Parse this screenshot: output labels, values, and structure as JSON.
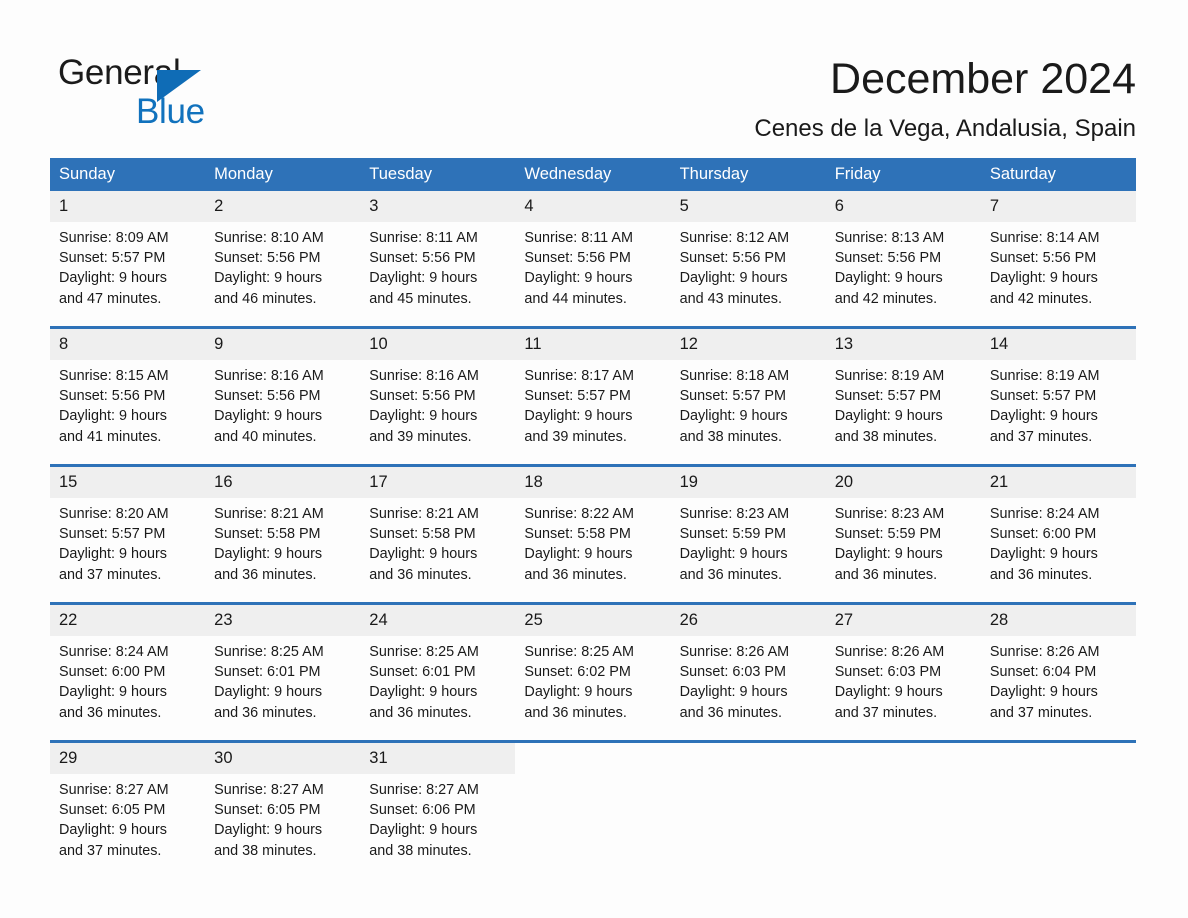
{
  "brand": {
    "name_part1": "General",
    "name_part2": "Blue",
    "triangle_color": "#0f6cb6",
    "blue_text_color": "#1172bd"
  },
  "header": {
    "title": "December 2024",
    "location": "Cenes de la Vega, Andalusia, Spain"
  },
  "theme": {
    "header_blue": "#2e72b8",
    "daynum_band": "#efefef",
    "page_background": "#fdfdfd",
    "text": "#1a1a1a"
  },
  "weekday_headers": [
    "Sunday",
    "Monday",
    "Tuesday",
    "Wednesday",
    "Thursday",
    "Friday",
    "Saturday"
  ],
  "weeks": [
    {
      "days": [
        {
          "date": "1",
          "sunrise": "Sunrise: 8:09 AM",
          "sunset": "Sunset: 5:57 PM",
          "daylight_line1": "Daylight: 9 hours",
          "daylight_line2": "and 47 minutes."
        },
        {
          "date": "2",
          "sunrise": "Sunrise: 8:10 AM",
          "sunset": "Sunset: 5:56 PM",
          "daylight_line1": "Daylight: 9 hours",
          "daylight_line2": "and 46 minutes."
        },
        {
          "date": "3",
          "sunrise": "Sunrise: 8:11 AM",
          "sunset": "Sunset: 5:56 PM",
          "daylight_line1": "Daylight: 9 hours",
          "daylight_line2": "and 45 minutes."
        },
        {
          "date": "4",
          "sunrise": "Sunrise: 8:11 AM",
          "sunset": "Sunset: 5:56 PM",
          "daylight_line1": "Daylight: 9 hours",
          "daylight_line2": "and 44 minutes."
        },
        {
          "date": "5",
          "sunrise": "Sunrise: 8:12 AM",
          "sunset": "Sunset: 5:56 PM",
          "daylight_line1": "Daylight: 9 hours",
          "daylight_line2": "and 43 minutes."
        },
        {
          "date": "6",
          "sunrise": "Sunrise: 8:13 AM",
          "sunset": "Sunset: 5:56 PM",
          "daylight_line1": "Daylight: 9 hours",
          "daylight_line2": "and 42 minutes."
        },
        {
          "date": "7",
          "sunrise": "Sunrise: 8:14 AM",
          "sunset": "Sunset: 5:56 PM",
          "daylight_line1": "Daylight: 9 hours",
          "daylight_line2": "and 42 minutes."
        }
      ]
    },
    {
      "days": [
        {
          "date": "8",
          "sunrise": "Sunrise: 8:15 AM",
          "sunset": "Sunset: 5:56 PM",
          "daylight_line1": "Daylight: 9 hours",
          "daylight_line2": "and 41 minutes."
        },
        {
          "date": "9",
          "sunrise": "Sunrise: 8:16 AM",
          "sunset": "Sunset: 5:56 PM",
          "daylight_line1": "Daylight: 9 hours",
          "daylight_line2": "and 40 minutes."
        },
        {
          "date": "10",
          "sunrise": "Sunrise: 8:16 AM",
          "sunset": "Sunset: 5:56 PM",
          "daylight_line1": "Daylight: 9 hours",
          "daylight_line2": "and 39 minutes."
        },
        {
          "date": "11",
          "sunrise": "Sunrise: 8:17 AM",
          "sunset": "Sunset: 5:57 PM",
          "daylight_line1": "Daylight: 9 hours",
          "daylight_line2": "and 39 minutes."
        },
        {
          "date": "12",
          "sunrise": "Sunrise: 8:18 AM",
          "sunset": "Sunset: 5:57 PM",
          "daylight_line1": "Daylight: 9 hours",
          "daylight_line2": "and 38 minutes."
        },
        {
          "date": "13",
          "sunrise": "Sunrise: 8:19 AM",
          "sunset": "Sunset: 5:57 PM",
          "daylight_line1": "Daylight: 9 hours",
          "daylight_line2": "and 38 minutes."
        },
        {
          "date": "14",
          "sunrise": "Sunrise: 8:19 AM",
          "sunset": "Sunset: 5:57 PM",
          "daylight_line1": "Daylight: 9 hours",
          "daylight_line2": "and 37 minutes."
        }
      ]
    },
    {
      "days": [
        {
          "date": "15",
          "sunrise": "Sunrise: 8:20 AM",
          "sunset": "Sunset: 5:57 PM",
          "daylight_line1": "Daylight: 9 hours",
          "daylight_line2": "and 37 minutes."
        },
        {
          "date": "16",
          "sunrise": "Sunrise: 8:21 AM",
          "sunset": "Sunset: 5:58 PM",
          "daylight_line1": "Daylight: 9 hours",
          "daylight_line2": "and 36 minutes."
        },
        {
          "date": "17",
          "sunrise": "Sunrise: 8:21 AM",
          "sunset": "Sunset: 5:58 PM",
          "daylight_line1": "Daylight: 9 hours",
          "daylight_line2": "and 36 minutes."
        },
        {
          "date": "18",
          "sunrise": "Sunrise: 8:22 AM",
          "sunset": "Sunset: 5:58 PM",
          "daylight_line1": "Daylight: 9 hours",
          "daylight_line2": "and 36 minutes."
        },
        {
          "date": "19",
          "sunrise": "Sunrise: 8:23 AM",
          "sunset": "Sunset: 5:59 PM",
          "daylight_line1": "Daylight: 9 hours",
          "daylight_line2": "and 36 minutes."
        },
        {
          "date": "20",
          "sunrise": "Sunrise: 8:23 AM",
          "sunset": "Sunset: 5:59 PM",
          "daylight_line1": "Daylight: 9 hours",
          "daylight_line2": "and 36 minutes."
        },
        {
          "date": "21",
          "sunrise": "Sunrise: 8:24 AM",
          "sunset": "Sunset: 6:00 PM",
          "daylight_line1": "Daylight: 9 hours",
          "daylight_line2": "and 36 minutes."
        }
      ]
    },
    {
      "days": [
        {
          "date": "22",
          "sunrise": "Sunrise: 8:24 AM",
          "sunset": "Sunset: 6:00 PM",
          "daylight_line1": "Daylight: 9 hours",
          "daylight_line2": "and 36 minutes."
        },
        {
          "date": "23",
          "sunrise": "Sunrise: 8:25 AM",
          "sunset": "Sunset: 6:01 PM",
          "daylight_line1": "Daylight: 9 hours",
          "daylight_line2": "and 36 minutes."
        },
        {
          "date": "24",
          "sunrise": "Sunrise: 8:25 AM",
          "sunset": "Sunset: 6:01 PM",
          "daylight_line1": "Daylight: 9 hours",
          "daylight_line2": "and 36 minutes."
        },
        {
          "date": "25",
          "sunrise": "Sunrise: 8:25 AM",
          "sunset": "Sunset: 6:02 PM",
          "daylight_line1": "Daylight: 9 hours",
          "daylight_line2": "and 36 minutes."
        },
        {
          "date": "26",
          "sunrise": "Sunrise: 8:26 AM",
          "sunset": "Sunset: 6:03 PM",
          "daylight_line1": "Daylight: 9 hours",
          "daylight_line2": "and 36 minutes."
        },
        {
          "date": "27",
          "sunrise": "Sunrise: 8:26 AM",
          "sunset": "Sunset: 6:03 PM",
          "daylight_line1": "Daylight: 9 hours",
          "daylight_line2": "and 37 minutes."
        },
        {
          "date": "28",
          "sunrise": "Sunrise: 8:26 AM",
          "sunset": "Sunset: 6:04 PM",
          "daylight_line1": "Daylight: 9 hours",
          "daylight_line2": "and 37 minutes."
        }
      ]
    },
    {
      "days": [
        {
          "date": "29",
          "sunrise": "Sunrise: 8:27 AM",
          "sunset": "Sunset: 6:05 PM",
          "daylight_line1": "Daylight: 9 hours",
          "daylight_line2": "and 37 minutes."
        },
        {
          "date": "30",
          "sunrise": "Sunrise: 8:27 AM",
          "sunset": "Sunset: 6:05 PM",
          "daylight_line1": "Daylight: 9 hours",
          "daylight_line2": "and 38 minutes."
        },
        {
          "date": "31",
          "sunrise": "Sunrise: 8:27 AM",
          "sunset": "Sunset: 6:06 PM",
          "daylight_line1": "Daylight: 9 hours",
          "daylight_line2": "and 38 minutes."
        },
        {
          "date": "",
          "sunrise": "",
          "sunset": "",
          "daylight_line1": "",
          "daylight_line2": ""
        },
        {
          "date": "",
          "sunrise": "",
          "sunset": "",
          "daylight_line1": "",
          "daylight_line2": ""
        },
        {
          "date": "",
          "sunrise": "",
          "sunset": "",
          "daylight_line1": "",
          "daylight_line2": ""
        },
        {
          "date": "",
          "sunrise": "",
          "sunset": "",
          "daylight_line1": "",
          "daylight_line2": ""
        }
      ]
    }
  ]
}
